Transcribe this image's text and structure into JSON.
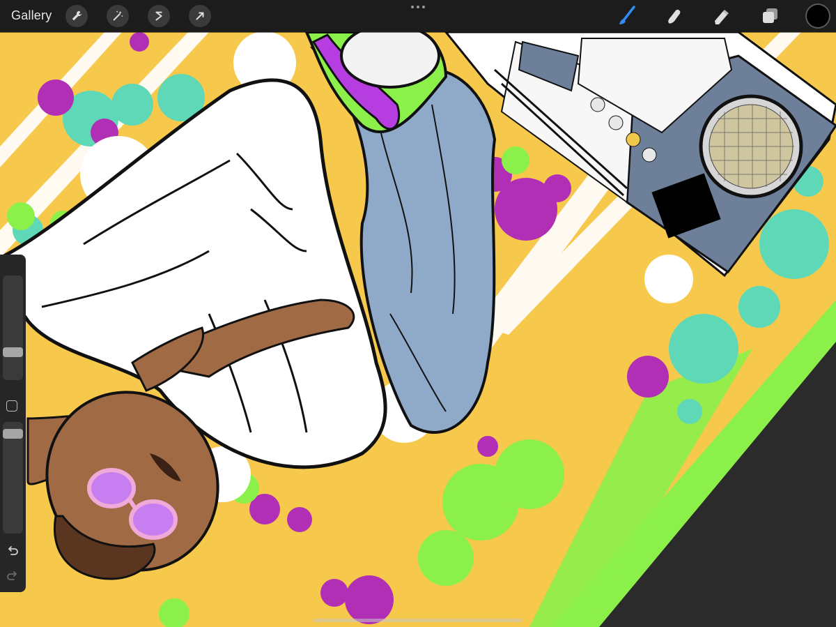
{
  "toolbar": {
    "gallery_label": "Gallery",
    "left_tools": [
      "wrench-icon",
      "magic-wand-icon",
      "selection-icon",
      "transform-arrow-icon"
    ],
    "right_tools": [
      "brush-icon",
      "smudge-icon",
      "eraser-icon",
      "layers-icon"
    ],
    "active_tool": "brush",
    "current_color": "#000000",
    "accent": "#2f8df5"
  },
  "sidebar": {
    "brush_size_level": 0.24,
    "opacity_level": 0.93
  },
  "artwork": {
    "palette": {
      "background_yellow": "#f6c84c",
      "splash_teal": "#5fd8b8",
      "splash_green": "#8cf04a",
      "splash_magenta": "#b12fb4",
      "jeans_blue": "#8faac8",
      "skin_brown": "#a06a45",
      "shoe_purple": "#b63ee0",
      "lens_pink": "#c77ef0",
      "boombox_slate": "#6e7f9a"
    }
  }
}
